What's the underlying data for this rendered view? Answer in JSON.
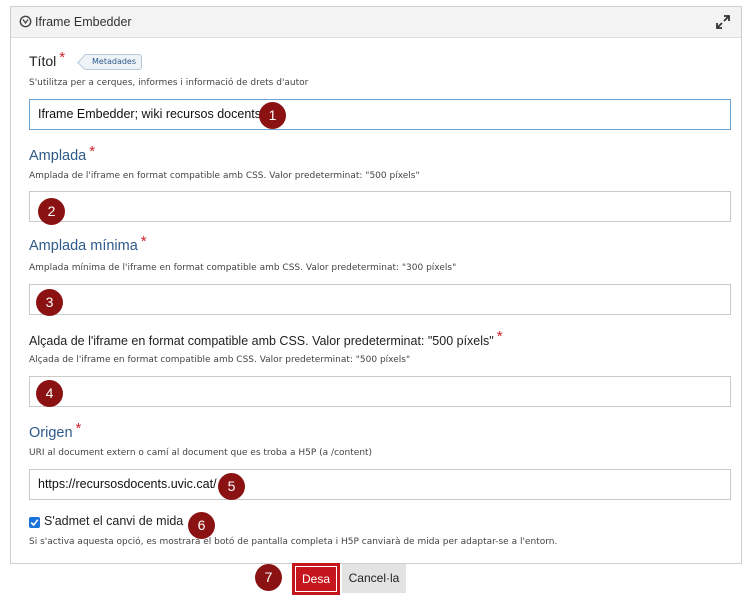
{
  "header": {
    "title": "Iframe Embedder",
    "icon": "h5p-icon",
    "expand_icon": "expand-icon"
  },
  "fields": {
    "title": {
      "label": "Títol",
      "required_mark": "*",
      "tag": "Metadades",
      "description": "S'utilitza per a cerques, informes i informació de drets d'autor",
      "value": "Iframe Embedder; wiki recursos docents"
    },
    "width": {
      "label": "Amplada",
      "required_mark": "*",
      "description": "Amplada de l'iframe en format compatible amb CSS. Valor predeterminat: \"500 píxels\"",
      "value": ""
    },
    "min_width": {
      "label": "Amplada mínima",
      "required_mark": "*",
      "description": "Amplada mínima de l'iframe en format compatible amb CSS. Valor predeterminat: \"300 píxels\"",
      "value": ""
    },
    "height": {
      "label": "Alçada de l'iframe en format compatible amb CSS. Valor predeterminat: \"500 píxels\"",
      "required_mark": "*",
      "description": "Alçada de l'iframe en format compatible amb CSS. Valor predeterminat: \"500 píxels\"",
      "value": ""
    },
    "source": {
      "label": "Origen",
      "required_mark": "*",
      "description": "URI al document extern o camí al document que es troba a H5P (a /content)",
      "value": "https://recursosdocents.uvic.cat/"
    },
    "resize": {
      "label": "S'admet el canvi de mida",
      "checked": true,
      "description": "Si s'activa aquesta opció, es mostrarà el botó de pantalla completa i H5P canviarà de mida per adaptar-se a l'entorn."
    }
  },
  "badges": [
    "1",
    "2",
    "3",
    "4",
    "5",
    "6",
    "7"
  ],
  "buttons": {
    "save": "Desa",
    "cancel": "Cancel·la"
  },
  "colors": {
    "required": "#d0202a",
    "label_blue": "#2e5a8a",
    "badge": "#8b1212",
    "save": "#c5161d",
    "checkbox": "#1a73d9"
  }
}
